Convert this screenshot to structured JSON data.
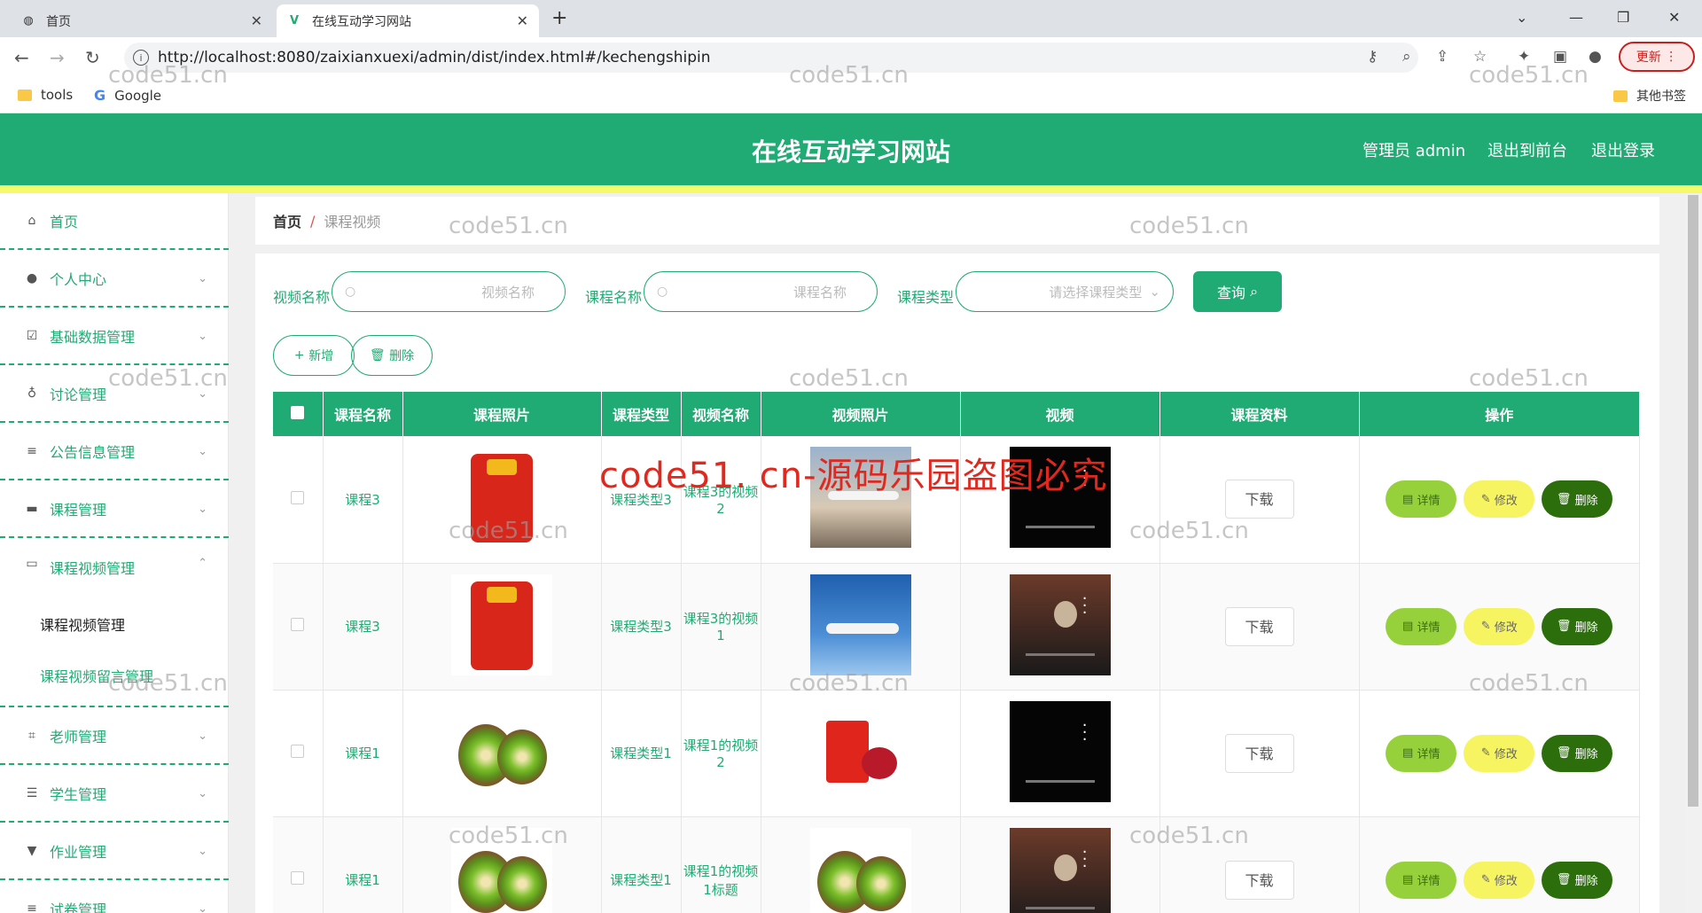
{
  "browser": {
    "tabs": [
      {
        "label": "首页",
        "active": false
      },
      {
        "label": "在线互动学习网站",
        "active": true
      }
    ],
    "url": "http://localhost:8080/zaixianxuexi/admin/dist/index.html#/kechengshipin",
    "update_label": "更新",
    "bookmarks": [
      "tools",
      "Google"
    ],
    "other_bookmarks": "其他书签"
  },
  "header": {
    "title": "在线互动学习网站",
    "user_label": "管理员 admin",
    "front_label": "退出到前台",
    "logout_label": "退出登录"
  },
  "sidebar": {
    "items": [
      {
        "label": "首页",
        "icon": "home-icon"
      },
      {
        "label": "个人中心",
        "icon": "user-icon"
      },
      {
        "label": "基础数据管理",
        "icon": "check-icon"
      },
      {
        "label": "讨论管理",
        "icon": "mic-icon"
      },
      {
        "label": "公告信息管理",
        "icon": "list-icon"
      },
      {
        "label": "课程管理",
        "icon": "chat-icon"
      },
      {
        "label": "课程视频管理",
        "icon": "card-icon"
      },
      {
        "label": "老师管理",
        "icon": "crop-icon"
      },
      {
        "label": "学生管理",
        "icon": "sliders-icon"
      },
      {
        "label": "作业管理",
        "icon": "pin-icon"
      },
      {
        "label": "试卷管理",
        "icon": "list-icon"
      }
    ],
    "subitems": [
      "课程视频管理",
      "课程视频留言管理"
    ]
  },
  "breadcrumb": {
    "home": "首页",
    "sep": "/",
    "current": "课程视频"
  },
  "filters": {
    "video_label": "视频名称",
    "video_placeholder": "视频名称",
    "course_label": "课程名称",
    "course_placeholder": "课程名称",
    "type_label": "课程类型",
    "type_placeholder": "请选择课程类型",
    "query_label": "查询"
  },
  "actions": {
    "add_label": "新增",
    "delete_label": "删除"
  },
  "table": {
    "headers": [
      "课程名称",
      "课程照片",
      "课程类型",
      "视频名称",
      "视频照片",
      "视频",
      "课程资料",
      "操作"
    ],
    "rows": [
      {
        "course": "课程3",
        "type": "课程类型3",
        "video": "课程3的视频2"
      },
      {
        "course": "课程3",
        "type": "课程类型3",
        "video": "课程3的视频1"
      },
      {
        "course": "课程1",
        "type": "课程类型1",
        "video": "课程1的视频2"
      },
      {
        "course": "课程1",
        "type": "课程类型1",
        "video": "课程1的视频1标题"
      }
    ],
    "download_label": "下载",
    "detail_label": "详情",
    "edit_label": "修改",
    "remove_label": "删除"
  },
  "watermark": "code51.cn",
  "watermark_red": "code51. cn-源码乐园盗图必究",
  "colors": {
    "primary": "#21ab74",
    "detail": "#96d13b",
    "edit": "#f7f461",
    "remove": "#2c6e0c"
  }
}
